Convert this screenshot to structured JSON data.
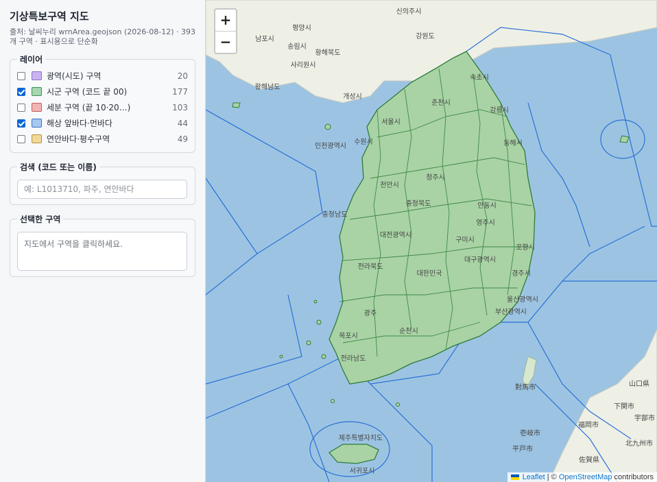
{
  "sidebar": {
    "title": "기상특보구역 지도",
    "subtitle": "출처: 날씨누리 wrnArea.geojson (2026-08-12) · 393개 구역 · 표시용으로 단순화",
    "layers_legend": "레이어",
    "layers": [
      {
        "label": "광역(시도) 구역",
        "count": "20",
        "checked": false,
        "color": "#c9b3f0",
        "border": "#8e6fc9"
      },
      {
        "label": "시군 구역 (코드 끝 00)",
        "count": "177",
        "checked": true,
        "color": "#a7d6b0",
        "border": "#3f8f50"
      },
      {
        "label": "세분 구역 (끝 10·20…)",
        "count": "103",
        "checked": false,
        "color": "#f2b3b3",
        "border": "#c25c5c"
      },
      {
        "label": "해상 앞바다·먼바다",
        "count": "44",
        "checked": true,
        "color": "#a8c8f0",
        "border": "#3a72c4"
      },
      {
        "label": "연안바다·평수구역",
        "count": "49",
        "checked": false,
        "color": "#f0d89a",
        "border": "#b8923a"
      }
    ],
    "search_legend": "검색 (코드 또는 이름)",
    "search_placeholder": "예: L1013710, 파주, 연안바다",
    "selected_legend": "선택한 구역",
    "selected_text": "지도에서 구역을 클릭하세요."
  },
  "map": {
    "zoom_in": "+",
    "zoom_out": "−",
    "attribution": {
      "leaflet": "Leaflet",
      "separator": " | © ",
      "osm": "OpenStreetMap",
      "contributors": " contributors"
    },
    "labels": [
      {
        "text": "신의주시"
      },
      {
        "text": "평양시"
      },
      {
        "text": "강원도"
      },
      {
        "text": "남포시"
      },
      {
        "text": "송림시"
      },
      {
        "text": "황해북도"
      },
      {
        "text": "사리원시"
      },
      {
        "text": "황해남도"
      },
      {
        "text": "개성시"
      },
      {
        "text": "속초시"
      },
      {
        "text": "춘천시"
      },
      {
        "text": "강릉시"
      },
      {
        "text": "서울시"
      },
      {
        "text": "동해시"
      },
      {
        "text": "인천광역시"
      },
      {
        "text": "수원시"
      },
      {
        "text": "천안시"
      },
      {
        "text": "청주시"
      },
      {
        "text": "충청북도"
      },
      {
        "text": "안동시"
      },
      {
        "text": "영주시"
      },
      {
        "text": "포항시"
      },
      {
        "text": "충청남도"
      },
      {
        "text": "대전광역시"
      },
      {
        "text": "구미시"
      },
      {
        "text": "대구광역시"
      },
      {
        "text": "경주시"
      },
      {
        "text": "울산광역시"
      },
      {
        "text": "전라북도"
      },
      {
        "text": "대한민국"
      },
      {
        "text": "부산광역시"
      },
      {
        "text": "광주"
      },
      {
        "text": "순천시"
      },
      {
        "text": "목포시"
      },
      {
        "text": "전라남도"
      },
      {
        "text": "제주특별자치도"
      },
      {
        "text": "서귀포시"
      },
      {
        "text": "對馬市"
      },
      {
        "text": "壱岐市"
      },
      {
        "text": "平戸市"
      },
      {
        "text": "福岡市"
      },
      {
        "text": "佐賀県"
      },
      {
        "text": "下関市"
      },
      {
        "text": "山口県"
      },
      {
        "text": "北九州市"
      },
      {
        "text": "宇部市"
      }
    ]
  }
}
